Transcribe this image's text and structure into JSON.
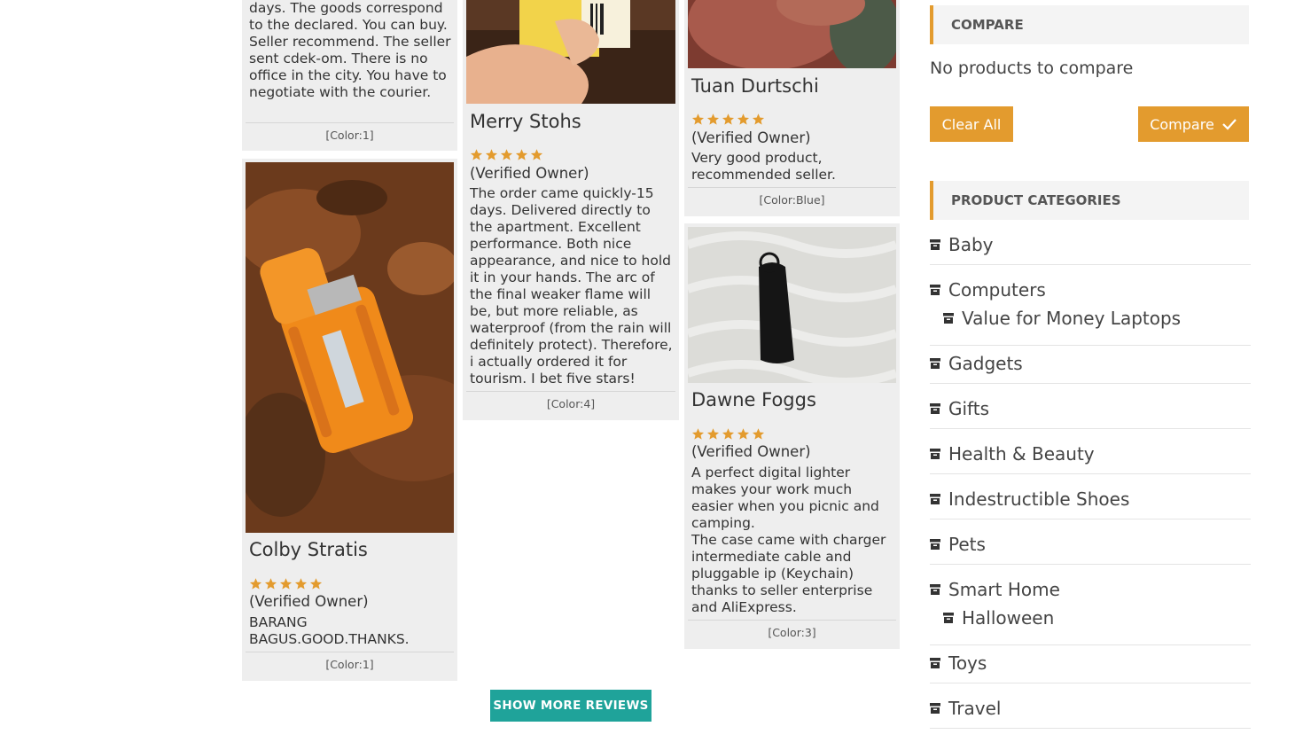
{
  "reviews": {
    "r1": {
      "text": "days. The goods correspond to the declared. You can buy. Seller recommend. The seller sent cdek-om. There is no office in the city. You have to negotiate with the courier.",
      "color": "[Color:1]"
    },
    "r2": {
      "name": "Colby Stratis",
      "owner": "(Verified Owner)",
      "text": "BARANG BAGUS.GOOD.THANKS.",
      "color": "[Color:1]"
    },
    "r3": {
      "name": "Merry Stohs",
      "owner": "(Verified Owner)",
      "text": "The order came quickly-15 days. Delivered directly to the apartment. Excellent performance. Both nice appearance, and nice to hold it in your hands. The arc of the final weaker flame will be, but more reliable, as waterproof (from the rain will definitely protect). Therefore, i actually ordered it for tourism. I bet five stars!",
      "color": "[Color:4]"
    },
    "r4": {
      "name": "Tuan Durtschi",
      "owner": "(Verified Owner)",
      "text": "Very good product, recommended seller.",
      "color": "[Color:Blue]"
    },
    "r5": {
      "name": "Dawne Foggs",
      "owner": "(Verified Owner)",
      "text": "A perfect digital lighter makes your work much easier when you picnic and camping.\nThe case came with charger intermediate cable and pluggable ip (Keychain) thanks to seller enterprise and AliExpress.",
      "color": "[Color:3]"
    },
    "rating": 5,
    "show_more": "SHOW MORE REVIEWS"
  },
  "compare": {
    "heading": "COMPARE",
    "empty": "No products to compare",
    "clear": "Clear All",
    "compare": "Compare"
  },
  "categories": {
    "heading": "PRODUCT CATEGORIES",
    "baby": "Baby",
    "computers": "Computers",
    "laptops": "Value for Money Laptops",
    "gadgets": "Gadgets",
    "gifts": "Gifts",
    "health": "Health & Beauty",
    "shoes": "Indestructible Shoes",
    "pets": "Pets",
    "smarthome": "Smart Home",
    "halloween": "Halloween",
    "toys": "Toys",
    "travel": "Travel"
  },
  "colors": {
    "accent": "#e39b2e",
    "teal": "#1fa39a",
    "card": "#eeeeee"
  }
}
